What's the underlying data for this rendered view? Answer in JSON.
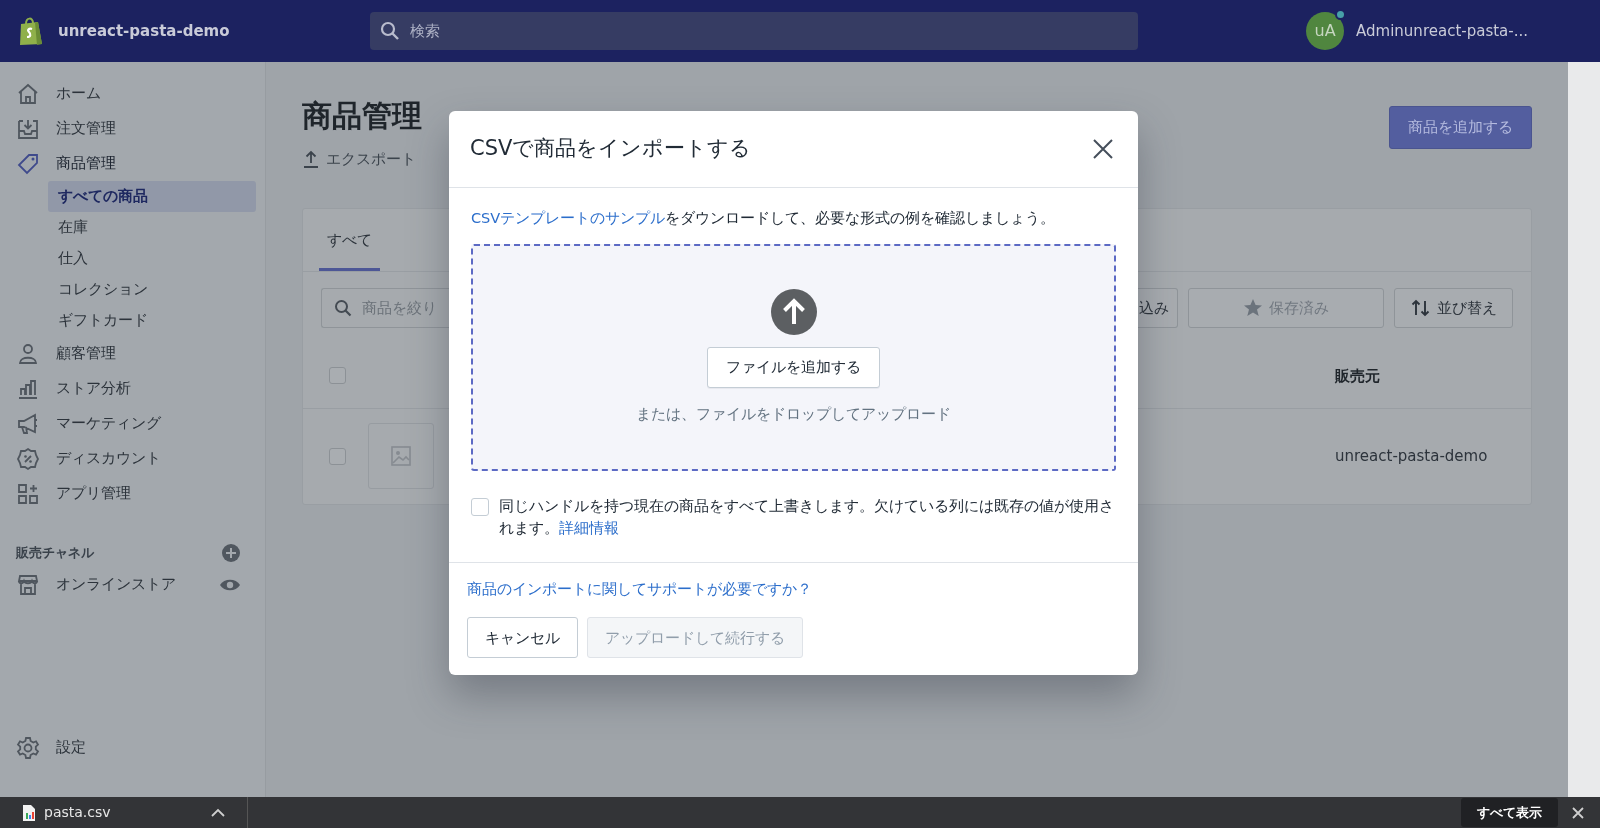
{
  "topbar": {
    "store_name": "unreact-pasta-demo",
    "search": {
      "placeholder": "検索"
    },
    "user": {
      "initials": "uA",
      "name": "Adminunreact-pasta-..."
    }
  },
  "sidebar": {
    "items": [
      {
        "label": "ホーム",
        "selected": false
      },
      {
        "label": "注文管理",
        "selected": false
      },
      {
        "label": "商品管理",
        "selected": true,
        "children": [
          {
            "label": "すべての商品",
            "selected": true
          },
          {
            "label": "在庫",
            "selected": false
          },
          {
            "label": "仕入",
            "selected": false
          },
          {
            "label": "コレクション",
            "selected": false
          },
          {
            "label": "ギフトカード",
            "selected": false
          }
        ]
      },
      {
        "label": "顧客管理",
        "selected": false
      },
      {
        "label": "ストア分析",
        "selected": false
      },
      {
        "label": "マーケティング",
        "selected": false
      },
      {
        "label": "ディスカウント",
        "selected": false
      },
      {
        "label": "アプリ管理",
        "selected": false
      }
    ],
    "channels_heading": "販売チャネル",
    "channels": [
      {
        "label": "オンラインストア"
      }
    ],
    "settings": "設定"
  },
  "page": {
    "title": "商品管理",
    "export": "エクスポート",
    "add_button": "商品を追加する",
    "tabs": [
      {
        "label": "すべて",
        "selected": true
      }
    ],
    "filter": {
      "placeholder": "商品を絞り"
    },
    "buttons": [
      {
        "label": "込み",
        "disabled": false
      },
      {
        "label": "保存済み",
        "disabled": true
      },
      {
        "label": "並び替え",
        "disabled": false
      }
    ],
    "columns": [
      {
        "label": "販売元"
      }
    ],
    "header_checked": false,
    "rows": [
      {
        "checked": false,
        "vendor": "unreact-pasta-demo"
      }
    ]
  },
  "modal": {
    "title": "CSVで商品をインポートする",
    "intro_link": "CSVテンプレートのサンプル",
    "intro_text": "をダウンロードして、必要な形式の例を確認しましょう。",
    "add_file": "ファイルを追加する",
    "drop_hint": "または、ファイルをドロップしてアップロード",
    "overwrite": {
      "checked": false,
      "text": "同じハンドルを持つ現在の商品をすべて上書きします。欠けている列には既存の値が使用されます。",
      "link": "詳細情報"
    },
    "help_link": "商品のインポートに関してサポートが必要ですか？",
    "buttons": [
      {
        "label": "キャンセル",
        "disabled": false
      },
      {
        "label": "アップロードして続行する",
        "disabled": true
      }
    ]
  },
  "download_bar": {
    "file": "pasta.csv",
    "show_all": "すべて表示"
  }
}
